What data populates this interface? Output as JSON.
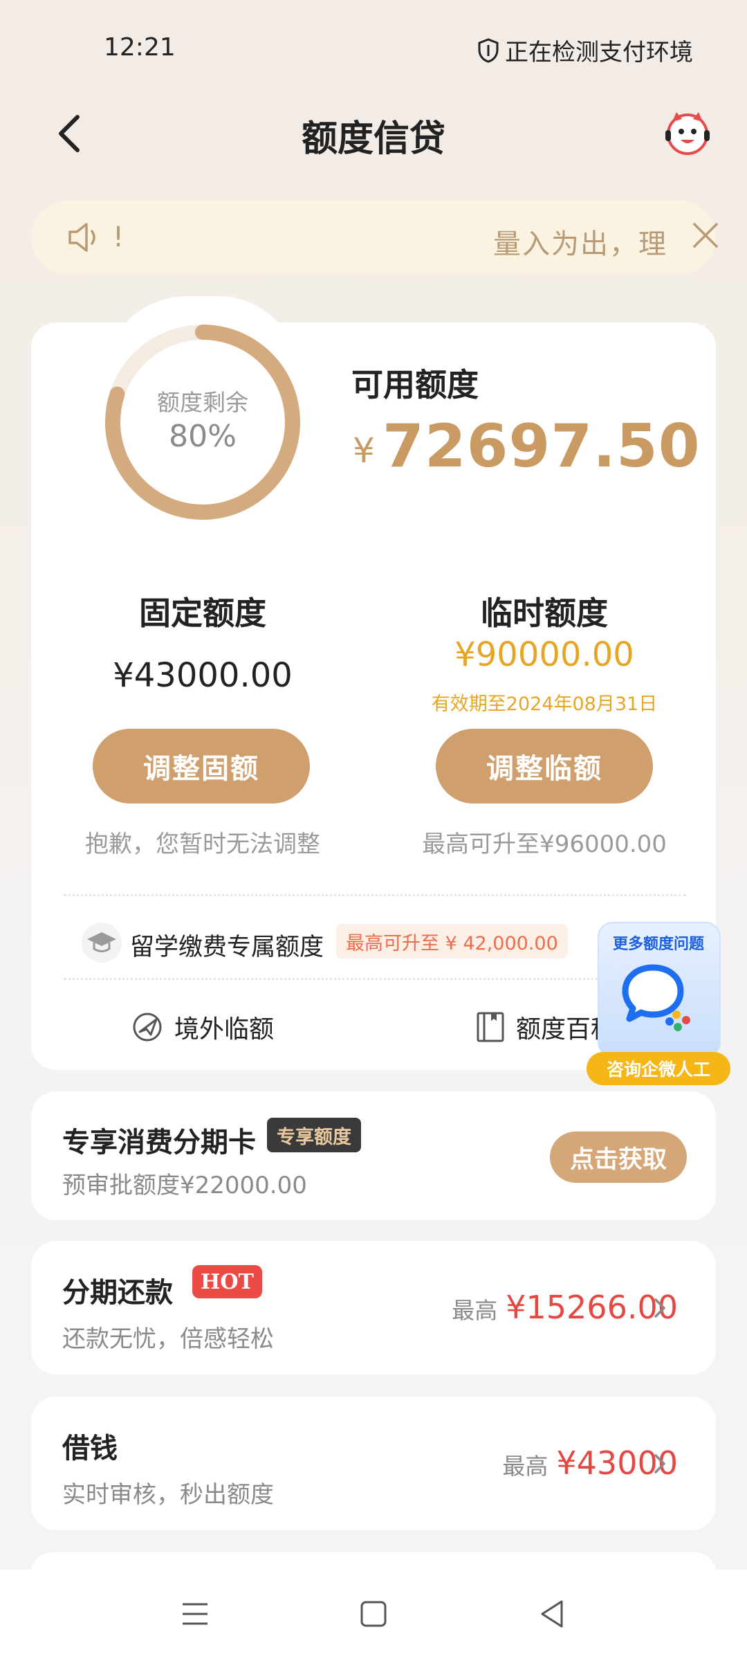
{
  "status": {
    "time": "12:21",
    "env_text": "正在检测支付环境"
  },
  "header": {
    "title": "额度信贷"
  },
  "notice": {
    "text": "量入为出，理",
    "marquee_fragment": "!"
  },
  "limit": {
    "ring_label": "额度剩余",
    "ring_percent_text": "80%",
    "ring_fraction": 0.8,
    "available_label": "可用额度",
    "currency": "¥",
    "available_amount": "72697.50",
    "fixed": {
      "title": "固定额度",
      "amount": "¥43000.00",
      "button": "调整固额",
      "note": "抱歉，您暂时无法调整"
    },
    "temp": {
      "title": "临时额度",
      "amount": "¥90000.00",
      "expiry": "有效期至2024年08月31日",
      "button": "调整临额",
      "note": "最高可升至¥96000.00"
    },
    "study": {
      "label": "留学缴费专属额度",
      "badge": "最高可升至 ¥ 42,000.00"
    },
    "links": [
      {
        "label": "境外临额"
      },
      {
        "label": "额度百科"
      }
    ]
  },
  "float_help": {
    "title": "更多额度问题",
    "button": "咨询企微人工"
  },
  "cards": {
    "installment_card": {
      "title": "专享消费分期卡",
      "tag": "专享额度",
      "sub": "预审批额度¥22000.00",
      "button": "点击获取"
    },
    "repay": {
      "title": "分期还款",
      "tag": "HOT",
      "sub": "还款无忧，倍感轻松",
      "max_label": "最高",
      "max_value": "¥15266.00"
    },
    "borrow": {
      "title": "借钱",
      "sub": "实时审核，秒出额度",
      "max_label": "最高",
      "max_value": "¥43000"
    }
  },
  "colors": {
    "gold": "#c99a62",
    "button": "#cfa06d",
    "amber": "#e6a524",
    "red": "#e54843"
  }
}
